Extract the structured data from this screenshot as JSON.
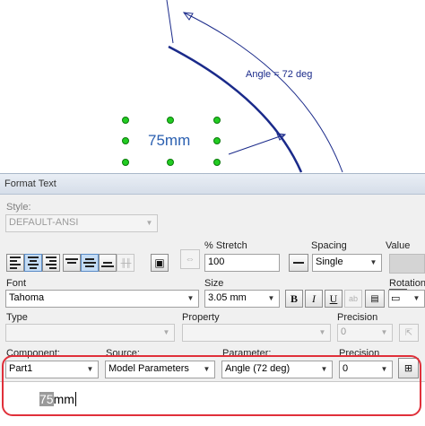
{
  "canvas": {
    "dimension_value": "75mm",
    "angle_label": "Angle = 72 deg"
  },
  "dialog": {
    "title": "Format Text",
    "style": {
      "label": "Style:",
      "value": "DEFAULT-ANSI"
    },
    "stretch": {
      "label": "% Stretch",
      "value": "100"
    },
    "spacing": {
      "label": "Spacing",
      "value": "Single"
    },
    "value_label": "Value",
    "font": {
      "label": "Font",
      "value": "Tahoma"
    },
    "size": {
      "label": "Size",
      "value": "3.05 mm"
    },
    "rotation_label": "Rotation",
    "format_buttons": {
      "bold": "B",
      "italic": "I",
      "underline": "U"
    },
    "type_label": "Type",
    "property_label": "Property",
    "precision_top_label": "Precision",
    "precision_top_value": "0",
    "component": {
      "label": "Component:",
      "value": "Part1"
    },
    "source": {
      "label": "Source:",
      "value": "Model Parameters"
    },
    "parameter": {
      "label": "Parameter:",
      "value": "Angle (72 deg)"
    },
    "precision": {
      "label": "Precision",
      "value": "0"
    },
    "edit_text": {
      "selected": "75",
      "rest": "mm"
    }
  },
  "colors": {
    "accent_blue": "#2a5fb0",
    "highlight_red": "#e0303a",
    "handle_green": "#22cc22"
  }
}
